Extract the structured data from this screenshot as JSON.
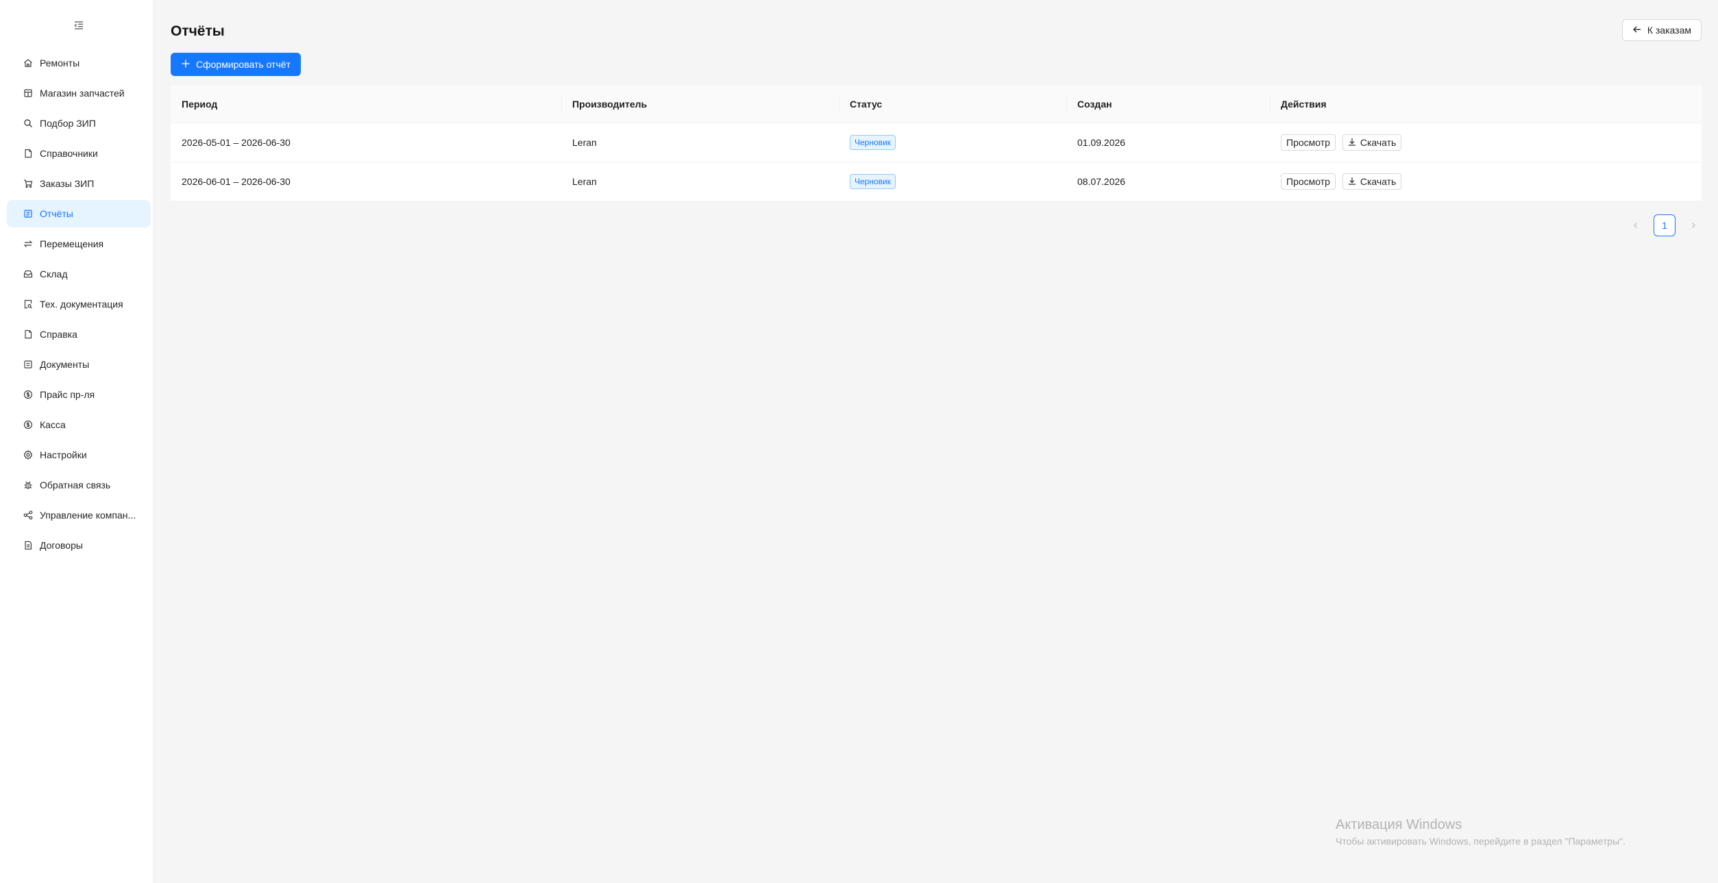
{
  "sidebar": {
    "collapse_icon": "menu-fold-icon",
    "items": [
      {
        "label": "Ремонты",
        "icon": "home-icon",
        "active": false
      },
      {
        "label": "Магазин запчастей",
        "icon": "shop-icon",
        "active": false
      },
      {
        "label": "Подбор ЗИП",
        "icon": "search-icon",
        "active": false
      },
      {
        "label": "Справочники",
        "icon": "book-icon",
        "active": false
      },
      {
        "label": "Заказы ЗИП",
        "icon": "cart-icon",
        "active": false
      },
      {
        "label": "Отчёты",
        "icon": "report-icon",
        "active": true
      },
      {
        "label": "Перемещения",
        "icon": "swap-icon",
        "active": false
      },
      {
        "label": "Склад",
        "icon": "inbox-icon",
        "active": false
      },
      {
        "label": "Тех. документация",
        "icon": "file-search-icon",
        "active": false
      },
      {
        "label": "Справка",
        "icon": "book-icon",
        "active": false
      },
      {
        "label": "Документы",
        "icon": "document-icon",
        "active": false
      },
      {
        "label": "Прайс пр-ля",
        "icon": "dollar-icon",
        "active": false
      },
      {
        "label": "Касса",
        "icon": "dollar-icon",
        "active": false
      },
      {
        "label": "Настройки",
        "icon": "settings-icon",
        "active": false
      },
      {
        "label": "Обратная связь",
        "icon": "bug-icon",
        "active": false
      },
      {
        "label": "Управление компан...",
        "icon": "share-icon",
        "active": false
      },
      {
        "label": "Договоры",
        "icon": "contract-icon",
        "active": false
      }
    ]
  },
  "header": {
    "title": "Отчёты",
    "back_label": "К заказам",
    "create_label": "Сформировать отчёт"
  },
  "table": {
    "columns": [
      "Период",
      "Производитель",
      "Статус",
      "Создан",
      "Действия"
    ],
    "rows": [
      {
        "period": "2026-05-01 – 2026-06-30",
        "manufacturer": "Leran",
        "status": "Черновик",
        "created": "01.09.2026",
        "view": "Просмотр",
        "download": "Скачать"
      },
      {
        "period": "2026-06-01 – 2026-06-30",
        "manufacturer": "Leran",
        "status": "Черновик",
        "created": "08.07.2026",
        "view": "Просмотр",
        "download": "Скачать"
      }
    ]
  },
  "pagination": {
    "current": "1"
  },
  "watermark": {
    "title": "Активация Windows",
    "subtitle": "Чтобы активировать Windows, перейдите в раздел \"Параметры\"."
  },
  "colors": {
    "accent": "#1677ff",
    "active_bg": "#e6f4ff",
    "page_bg": "#f5f5f5"
  }
}
